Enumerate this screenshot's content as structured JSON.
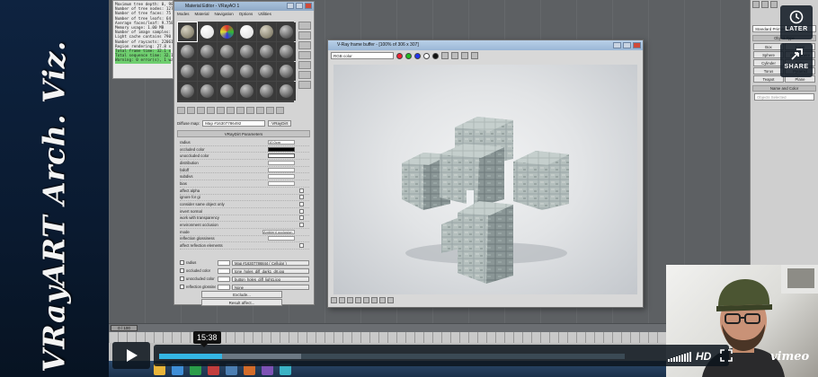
{
  "branding": {
    "text": "VRayART Arch. Viz."
  },
  "render_log": {
    "lines": [
      "Maximum tree depth: 0, 9873",
      "Number of tree nodes: 127",
      "Number of tree faces: 75",
      "Number of tree leafs: 64",
      "Average faces/leaf: 9.75868",
      "Memory usage: 1.00 MB",
      "Number of image samples: ",
      "Light cache contains 790 samples",
      "Number of raycasts: 2206187",
      "Region rendering: 27.8 s",
      "Total frame time: 32.1 s",
      "Total sequence time: 32.1 s",
      "Warning: 0 error(s), 1 warning(s)"
    ]
  },
  "material_editor": {
    "title": "Material Editor - VRayAO 1",
    "menu": [
      "Modes",
      "Material",
      "Navigation",
      "Options",
      "Utilities"
    ],
    "diffuse_label": "Diffuse map:",
    "map_name": "Map #16307786492",
    "map_type": "VRayDirt",
    "rollout_title": "VRayDirt Parameters",
    "params": [
      {
        "label": "radius",
        "kind": "field"
      },
      {
        "label": "occluded color",
        "kind": "swatch-black"
      },
      {
        "label": "unoccluded color",
        "kind": "swatch-white"
      },
      {
        "label": "distribution",
        "kind": "field"
      },
      {
        "label": "falloff",
        "kind": "field"
      },
      {
        "label": "subdivs",
        "kind": "field"
      },
      {
        "label": "bias",
        "kind": "field"
      },
      {
        "label": "affect alpha",
        "kind": "check"
      },
      {
        "label": "ignore for gi",
        "kind": "check"
      },
      {
        "label": "consider same object only",
        "kind": "check"
      },
      {
        "label": "invert normal",
        "kind": "check"
      },
      {
        "label": "work with transparency",
        "kind": "check"
      },
      {
        "label": "environment occlusion",
        "kind": "check"
      },
      {
        "label": "mode",
        "kind": "field"
      },
      {
        "label": "reflection glossiness",
        "kind": "field"
      },
      {
        "label": "affect reflection elements",
        "kind": "check"
      }
    ],
    "mode_value": "Ambient occlusion",
    "radius_value": "10.0cm",
    "map_rows": [
      {
        "name": "radius",
        "map": "Map #16307786844 ( Cellular )"
      },
      {
        "name": "occluded color",
        "map": "tone_holes_diff_dark1_drt.jpg"
      },
      {
        "name": "unoccluded color",
        "map": "button_holes_diff_light1.jpg"
      },
      {
        "name": "reflection glossiness",
        "map": "None"
      }
    ],
    "exclude_button": "Exclude...",
    "result_button": "Result affect..."
  },
  "vfb": {
    "title": "V-Ray frame buffer - [100% of 306 x 307]",
    "channel": "RGB color"
  },
  "command_panel": {
    "dropdown": "Standard Primitives",
    "section_object": "Object Type",
    "autogrid": "AutoGrid",
    "primitives": [
      "Box",
      "Cone",
      "Sphere",
      "GeoSphere",
      "Cylinder",
      "Tube",
      "Torus",
      "Pyramid",
      "Teapot",
      "Plane"
    ],
    "section_name": "Name and Color",
    "name_placeholder": "Objects Selected"
  },
  "overlay": {
    "later_label": "LATER",
    "share_label": "SHARE"
  },
  "timeline": {
    "frame": "0 / 100"
  },
  "player": {
    "current_time": "15:38",
    "progress": 0.135,
    "buffered": 0.305,
    "hd_label": "HD",
    "brand": "vimeo"
  },
  "colors": {
    "accent": "#34b6e4",
    "panel": "#d4d4d4",
    "brand_bg": "#0e2340"
  }
}
